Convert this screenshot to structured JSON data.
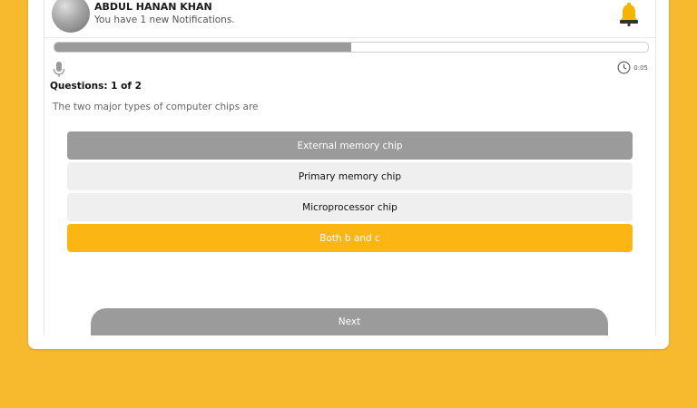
{
  "header": {
    "user_name": "ABDUL HANAN KHAN",
    "notification_text": "You have 1 new Notifications."
  },
  "quiz": {
    "progress": 0.5,
    "timer": "0:05",
    "question_number": "Questions: 1 of 2",
    "question_text": "The two major types of computer chips are",
    "options": [
      {
        "label": "External memory chip",
        "state": "disabled"
      },
      {
        "label": "Primary memory chip",
        "state": "default"
      },
      {
        "label": "Microprocessor chip",
        "state": "default"
      },
      {
        "label": "Both b and c",
        "state": "selected"
      }
    ],
    "next_label": "Next"
  },
  "colors": {
    "background": "#F7B92E",
    "accent": "#FCB614",
    "muted": "#9B9B9B"
  },
  "icons": {
    "bell": "bell-icon",
    "mic": "microphone-icon",
    "clock": "clock-icon"
  }
}
